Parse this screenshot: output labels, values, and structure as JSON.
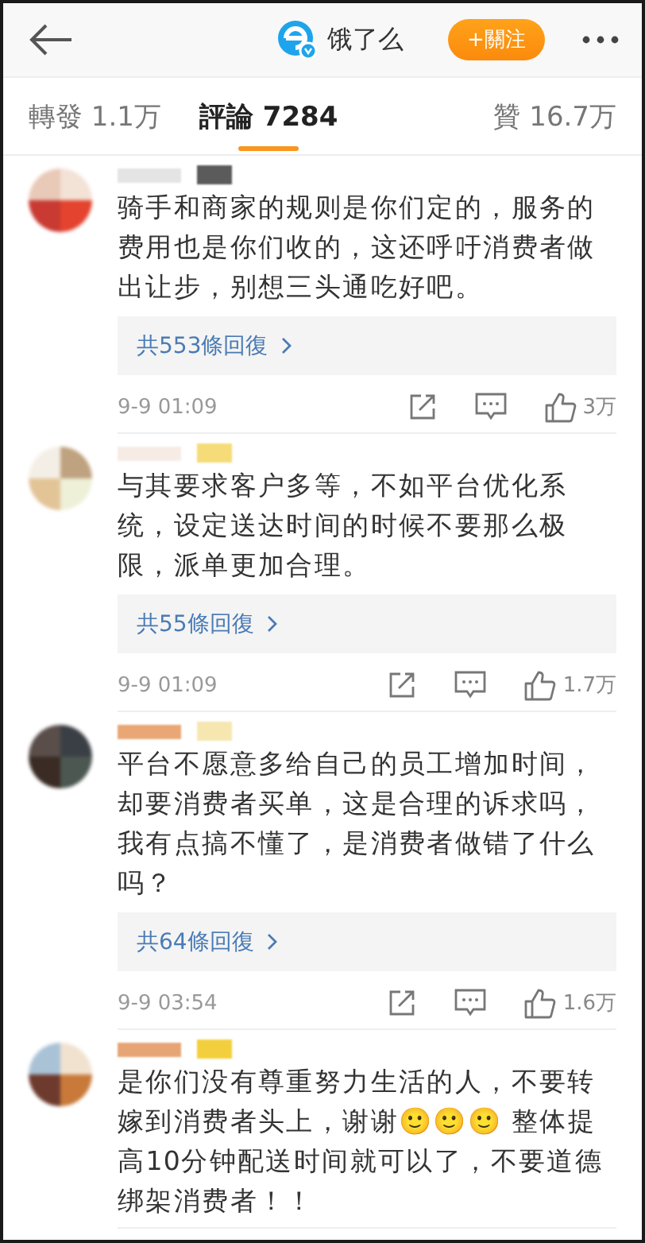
{
  "header": {
    "account_name": "饿了么",
    "follow_button": "+關注"
  },
  "tabs": [
    {
      "label": "轉發 1.1万",
      "selected": false
    },
    {
      "label": "評論 7284",
      "selected": true
    },
    {
      "label": "贊 16.7万",
      "selected": false
    }
  ],
  "comments": [
    {
      "text": "骑手和商家的规则是你们定的，服务的费用也是你们收的，这还呼吁消费者做出让步，别想三头通吃好吧。",
      "replies": "共553條回復",
      "time": "9-9 01:09",
      "likes": "3万"
    },
    {
      "text": "与其要求客户多等，不如平台优化系统，设定送达时间的时候不要那么极限，派单更加合理。",
      "replies": "共55條回復",
      "time": "9-9 01:09",
      "likes": "1.7万"
    },
    {
      "text": "平台不愿意多给自己的员工增加时间，却要消费者买单，这是合理的诉求吗，我有点搞不懂了，是消费者做错了什么吗？",
      "replies": "共64條回復",
      "time": "9-9 03:54",
      "likes": "1.6万"
    },
    {
      "text": "是你们没有尊重努力生活的人，不要转嫁到消费者头上，谢谢🙂🙂🙂 整体提高10分钟配送时间就可以了，不要道德绑架消费者！！"
    }
  ]
}
